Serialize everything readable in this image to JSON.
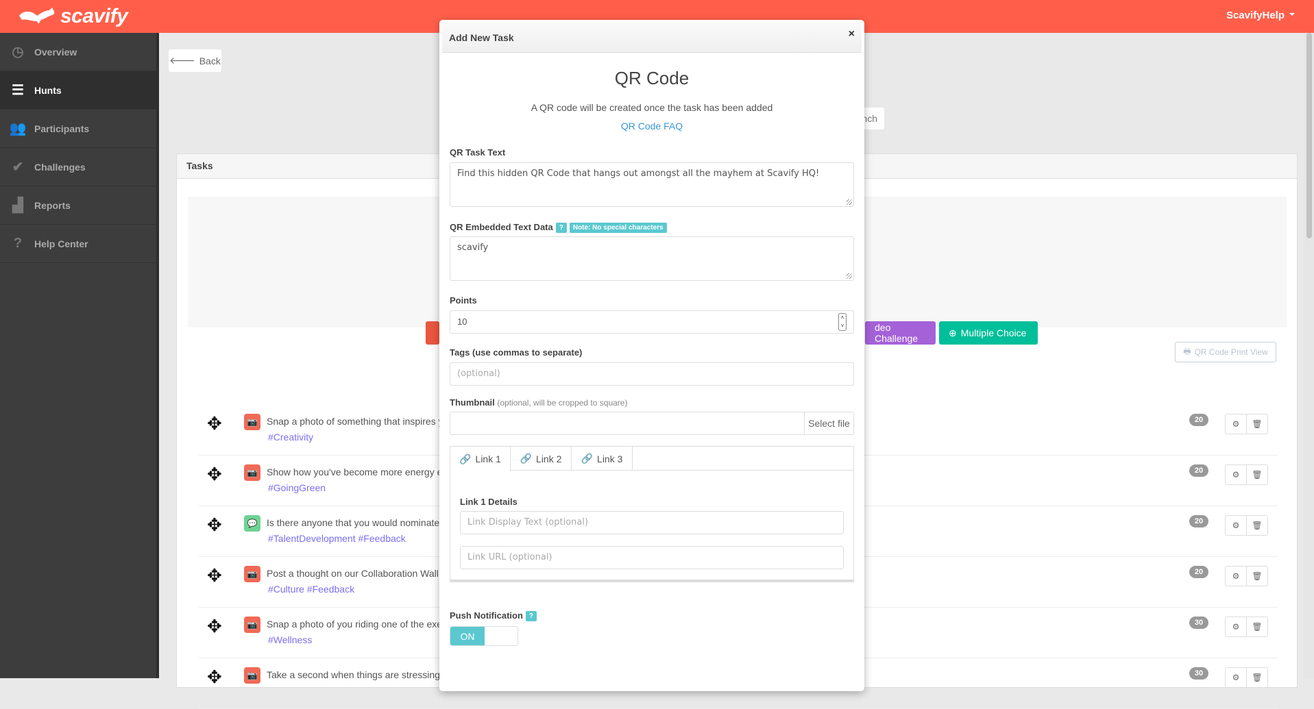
{
  "topbar": {
    "brand": "scavify",
    "user_menu": "ScavifyHelp",
    "color": "#ff5f4a"
  },
  "sidebar": {
    "items": [
      {
        "label": "Overview",
        "icon": "dashboard-icon",
        "active": false
      },
      {
        "label": "Hunts",
        "icon": "list-icon",
        "active": true
      },
      {
        "label": "Participants",
        "icon": "users-icon",
        "active": false
      },
      {
        "label": "Challenges",
        "icon": "check-circle-icon",
        "active": false
      },
      {
        "label": "Reports",
        "icon": "bar-chart-icon",
        "active": false
      },
      {
        "label": "Help Center",
        "icon": "question-circle-icon",
        "active": false
      }
    ]
  },
  "main": {
    "back_label": "Back",
    "launch_partial": "nch",
    "tasks_title": "Tasks",
    "add_buttons": [
      {
        "label": "deo Challenge",
        "color": "#a461d8"
      },
      {
        "label": "Multiple Choice",
        "color": "#00bf9a"
      }
    ],
    "print_view_label": "QR Code Print View",
    "tasks": [
      {
        "text": "Snap a photo of something that inspires y",
        "tags": "#Creativity",
        "type": "photo",
        "points": "20"
      },
      {
        "text": "Show how you've become more energy e",
        "tags": "#GoingGreen",
        "type": "photo",
        "points": "20"
      },
      {
        "text": "Is there anyone that you would nominate",
        "tags": "#TalentDevelopment #Feedback",
        "type": "text",
        "points": "20"
      },
      {
        "text": "Post a thought on our Collaboration Wall.",
        "tags": "#Culture #Feedback",
        "type": "photo",
        "points": "20"
      },
      {
        "text": "Snap a photo of you riding one of the exe",
        "tags": "#Wellness",
        "type": "photo",
        "points": "30"
      },
      {
        "text": "Take a second when things are stressing",
        "tags": "",
        "type": "photo",
        "points": "30"
      }
    ]
  },
  "modal": {
    "title": "Add New Task",
    "close": "×",
    "heading": "QR Code",
    "description": "A QR code will be created once the task has been added",
    "faq_link": "QR Code FAQ",
    "task_text_label": "QR Task Text",
    "task_text_value": "Find this hidden QR Code that hangs out amongst all the mayhem at Scavify HQ!",
    "embedded_label": "QR Embedded Text Data",
    "help_badge": "?",
    "note_badge": "Note: No special characters",
    "embedded_value": "scavify",
    "points_label": "Points",
    "points_value": "10",
    "tags_label": "Tags (use commas to separate)",
    "tags_placeholder": "(optional)",
    "thumbnail_label": "Thumbnail",
    "thumbnail_hint": "(optional, will be cropped to square)",
    "select_file": "Select file",
    "link_tabs": [
      "Link 1",
      "Link 2",
      "Link 3"
    ],
    "active_tab": "Link 1",
    "link_details_label": "Link 1 Details",
    "link_display_placeholder": "Link Display Text (optional)",
    "link_url_placeholder": "Link URL (optional)",
    "push_label": "Push Notification",
    "push_state": "ON",
    "accent": "#5bc8d0"
  }
}
